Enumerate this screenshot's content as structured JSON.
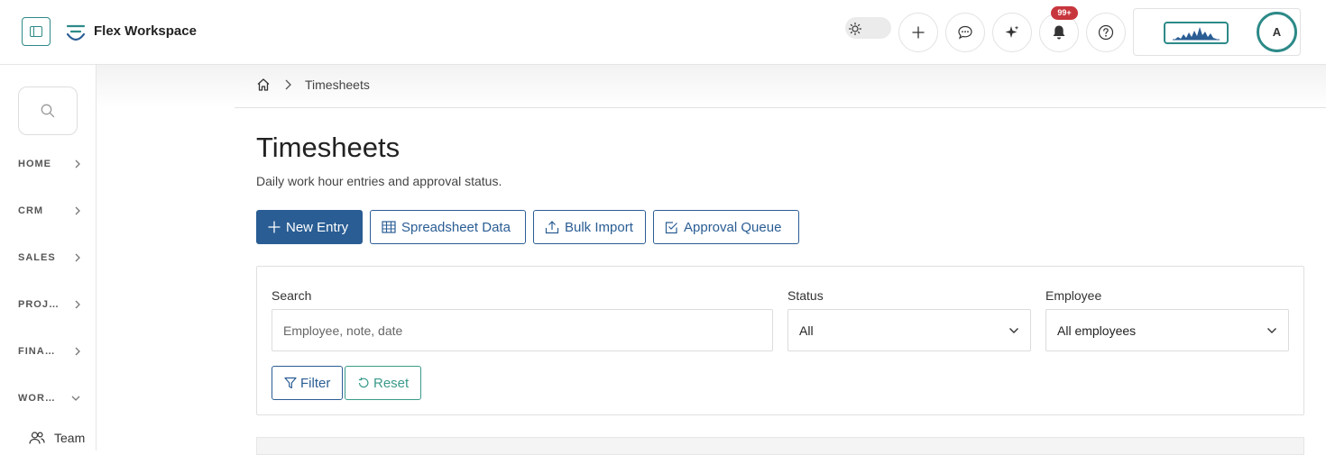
{
  "header": {
    "brand": "Flex Workspace",
    "notification_badge": "99+",
    "avatar_initial": "A"
  },
  "sidebar": {
    "items": [
      {
        "label": "HOME",
        "expanded": false
      },
      {
        "label": "CRM",
        "expanded": false
      },
      {
        "label": "SALES",
        "expanded": false
      },
      {
        "label": "PROJ…",
        "expanded": false
      },
      {
        "label": "FINA…",
        "expanded": false
      },
      {
        "label": "WOR…",
        "expanded": true
      }
    ],
    "sub_items": [
      {
        "label": "Team"
      }
    ]
  },
  "breadcrumb": {
    "current": "Timesheets"
  },
  "page": {
    "title": "Timesheets",
    "subtitle": "Daily work hour entries and approval status."
  },
  "actions": {
    "new_entry": "New Entry",
    "spreadsheet": "Spreadsheet Data",
    "bulk_import": "Bulk Import",
    "approval_queue": "Approval Queue"
  },
  "filters": {
    "search_label": "Search",
    "search_placeholder": "Employee, note, date",
    "status_label": "Status",
    "status_value": "All",
    "employee_label": "Employee",
    "employee_value": "All employees",
    "filter_button": "Filter",
    "reset_button": "Reset"
  },
  "colors": {
    "primary": "#2a5d94",
    "accent": "#2d8a88",
    "badge": "#c8363d"
  }
}
